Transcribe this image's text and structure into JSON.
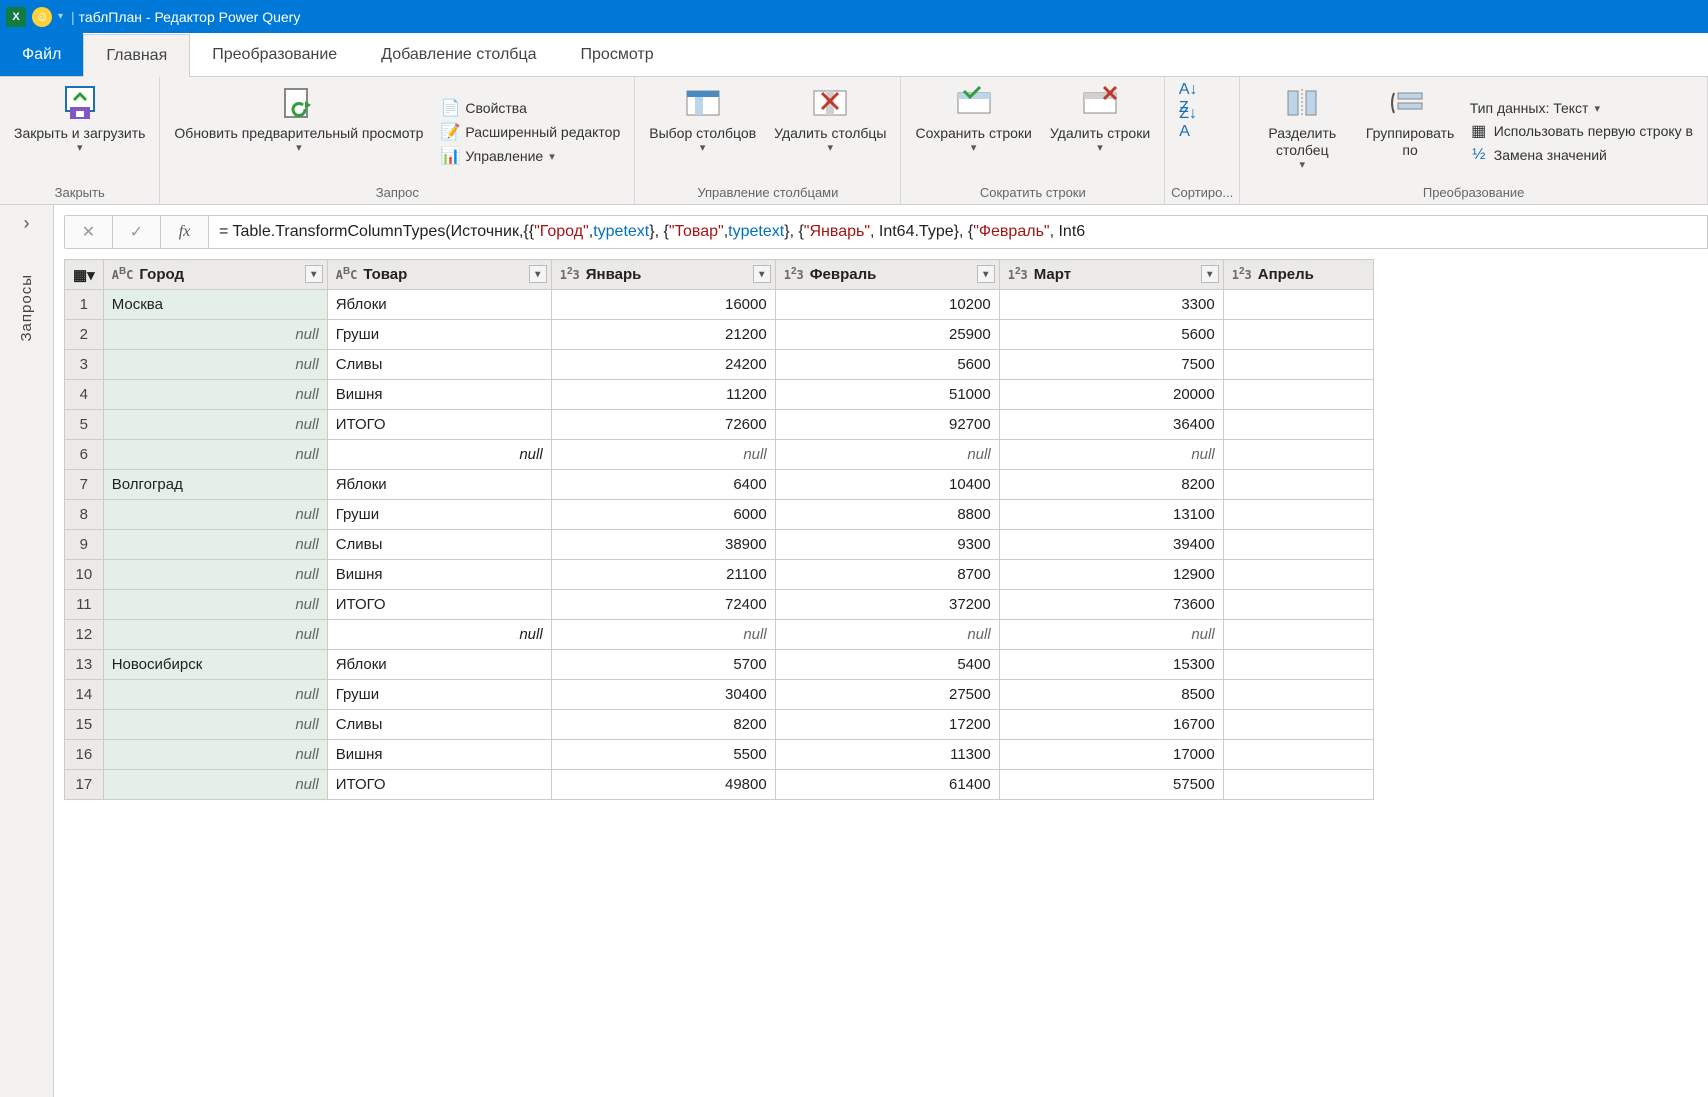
{
  "title": "таблПлан - Редактор Power Query",
  "tabs": {
    "file": "Файл",
    "home": "Главная",
    "transform": "Преобразование",
    "addcol": "Добавление столбца",
    "view": "Просмотр"
  },
  "ribbon": {
    "close_group": "Закрыть",
    "close_load": "Закрыть и загрузить",
    "query_group": "Запрос",
    "refresh": "Обновить предварительный просмотр",
    "props": "Свойства",
    "adv": "Расширенный редактор",
    "manage": "Управление",
    "cols_group": "Управление столбцами",
    "choose": "Выбор столбцов",
    "remove": "Удалить столбцы",
    "rows_group": "Сократить строки",
    "keep": "Сохранить строки",
    "delrows": "Удалить строки",
    "sort_group": "Сортиро...",
    "split": "Разделить столбец",
    "group": "Группировать по",
    "trans_group": "Преобразование",
    "dtype": "Тип данных: Текст",
    "firstrow": "Использовать первую строку в",
    "replace": "Замена значений"
  },
  "side": {
    "queries": "Запросы"
  },
  "formula": {
    "prefix": "= Table.TransformColumnTypes(Источник,{{",
    "parts": [
      {
        "t": "str",
        "v": "\"Город\""
      },
      {
        "t": "p",
        "v": ", "
      },
      {
        "t": "kw",
        "v": "type"
      },
      {
        "t": "p",
        "v": " "
      },
      {
        "t": "kw",
        "v": "text"
      },
      {
        "t": "p",
        "v": "}, {"
      },
      {
        "t": "str",
        "v": "\"Товар\""
      },
      {
        "t": "p",
        "v": ", "
      },
      {
        "t": "kw",
        "v": "type"
      },
      {
        "t": "p",
        "v": " "
      },
      {
        "t": "kw",
        "v": "text"
      },
      {
        "t": "p",
        "v": "}, {"
      },
      {
        "t": "str",
        "v": "\"Январь\""
      },
      {
        "t": "p",
        "v": ", Int64.Type}, {"
      },
      {
        "t": "str",
        "v": "\"Февраль\""
      },
      {
        "t": "p",
        "v": ", Int6"
      }
    ]
  },
  "columns": [
    "Город",
    "Товар",
    "Январь",
    "Февраль",
    "Март",
    "Апрель"
  ],
  "rows": [
    {
      "city": "Москва",
      "prod": "Яблоки",
      "m1": 16000,
      "m2": 10200,
      "m3": 3300
    },
    {
      "city": null,
      "prod": "Груши",
      "m1": 21200,
      "m2": 25900,
      "m3": 5600
    },
    {
      "city": null,
      "prod": "Сливы",
      "m1": 24200,
      "m2": 5600,
      "m3": 7500
    },
    {
      "city": null,
      "prod": "Вишня",
      "m1": 11200,
      "m2": 51000,
      "m3": 20000
    },
    {
      "city": null,
      "prod": "ИТОГО",
      "m1": 72600,
      "m2": 92700,
      "m3": 36400
    },
    {
      "city": null,
      "prod": null,
      "m1": null,
      "m2": null,
      "m3": null
    },
    {
      "city": "Волгоград",
      "prod": "Яблоки",
      "m1": 6400,
      "m2": 10400,
      "m3": 8200
    },
    {
      "city": null,
      "prod": "Груши",
      "m1": 6000,
      "m2": 8800,
      "m3": 13100
    },
    {
      "city": null,
      "prod": "Сливы",
      "m1": 38900,
      "m2": 9300,
      "m3": 39400
    },
    {
      "city": null,
      "prod": "Вишня",
      "m1": 21100,
      "m2": 8700,
      "m3": 12900
    },
    {
      "city": null,
      "prod": "ИТОГО",
      "m1": 72400,
      "m2": 37200,
      "m3": 73600
    },
    {
      "city": null,
      "prod": null,
      "m1": null,
      "m2": null,
      "m3": null
    },
    {
      "city": "Новосибирск",
      "prod": "Яблоки",
      "m1": 5700,
      "m2": 5400,
      "m3": 15300
    },
    {
      "city": null,
      "prod": "Груши",
      "m1": 30400,
      "m2": 27500,
      "m3": 8500
    },
    {
      "city": null,
      "prod": "Сливы",
      "m1": 8200,
      "m2": 17200,
      "m3": 16700
    },
    {
      "city": null,
      "prod": "Вишня",
      "m1": 5500,
      "m2": 11300,
      "m3": 17000
    },
    {
      "city": null,
      "prod": "ИТОГО",
      "m1": 49800,
      "m2": 61400,
      "m3": 57500
    }
  ]
}
